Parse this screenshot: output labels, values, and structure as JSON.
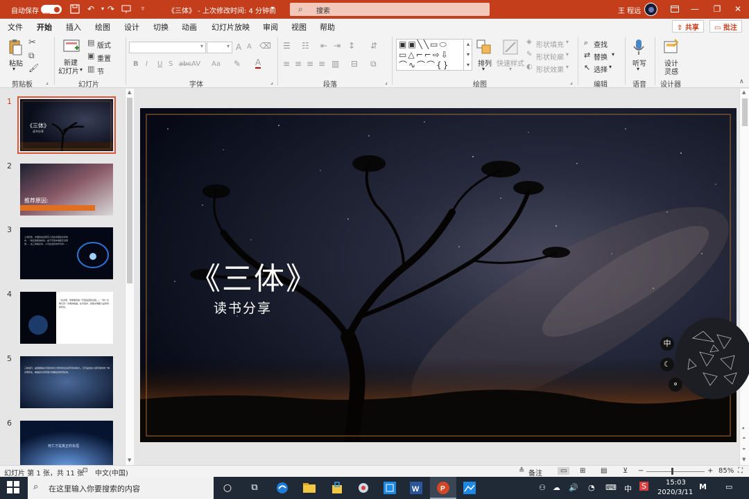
{
  "titlebar": {
    "autosave_label": "自动保存",
    "autosave_state": "开",
    "doc_title": "《三体》 - 上次修改时间: 4 分钟前",
    "search_placeholder": "搜索",
    "user_name": "王 程远"
  },
  "menu": {
    "tabs": [
      "文件",
      "开始",
      "插入",
      "绘图",
      "设计",
      "切换",
      "动画",
      "幻灯片放映",
      "审阅",
      "视图",
      "帮助"
    ],
    "active": "开始",
    "share_label": "共享",
    "comment_label": "批注"
  },
  "ribbon": {
    "clipboard": {
      "paste": "粘贴",
      "label": "剪贴板"
    },
    "slides": {
      "new_slide_l1": "新建",
      "new_slide_l2": "幻灯片",
      "layout": "版式",
      "reset": "重置",
      "section": "节",
      "label": "幻灯片"
    },
    "font": {
      "label": "字体",
      "bold": "B",
      "italic": "I",
      "underline": "U",
      "strike": "S",
      "shadow": "abc",
      "spacing": "AV",
      "case": "Aa",
      "grow": "A",
      "shrink": "A"
    },
    "paragraph": {
      "label": "段落"
    },
    "drawing": {
      "arrange": "排列",
      "quick_styles": "快速样式",
      "fill": "形状填充",
      "outline": "形状轮廓",
      "effects": "形状效果",
      "label": "绘图"
    },
    "editing": {
      "find": "查找",
      "replace": "替换",
      "select": "选择",
      "label": "编辑"
    },
    "voice": {
      "dictate": "听写",
      "label": "语音"
    },
    "designer": {
      "ideas_l1": "设计",
      "ideas_l2": "灵感",
      "label": "设计器"
    }
  },
  "slides_panel": {
    "numbers": [
      "1",
      "2",
      "3",
      "4",
      "5",
      "6"
    ],
    "selected": "1",
    "thumb1_title": "《三体》",
    "thumb1_sub": "读书分享",
    "thumb2_text": "推荐原因:",
    "thumb3_text": "上世纪末，中国的某某研究人员在中国某次革命中，一些实验取得成功，由于宇宙中恒星无法预测……在三体星系中，人们在漫长的岁月中……",
    "thumb4_text": "「在这里，你能看到第一宇宙速度的全貌。」一种一文明与另一文明的相遇。在宇宙中，其他文明都只是暂时的存在。",
    "thumb5_text": "三体运行，是根据着在宇宙中的引力而寻找在生存环境中的人，它们是处在人类宇宙中的一种文明存在，被描述为具有强大侵略性的智慧生命。",
    "thumb6_text": "死亡才是真正的永恒"
  },
  "slide": {
    "title": "《三体》",
    "subtitle": "读书分享"
  },
  "floating": {
    "ime_char": "中"
  },
  "statusbar": {
    "slide_info": "幻灯片 第 1 张，共 11 张",
    "language": "中文(中国)",
    "notes": "备注",
    "zoom": "85%"
  },
  "taskbar": {
    "search_placeholder": "在这里输入你要搜索的内容",
    "ime": "中",
    "time": "15:03",
    "date": "2020/3/11"
  },
  "colors": {
    "accent": "#c43e1c",
    "slide_border": "#a86a2c"
  }
}
